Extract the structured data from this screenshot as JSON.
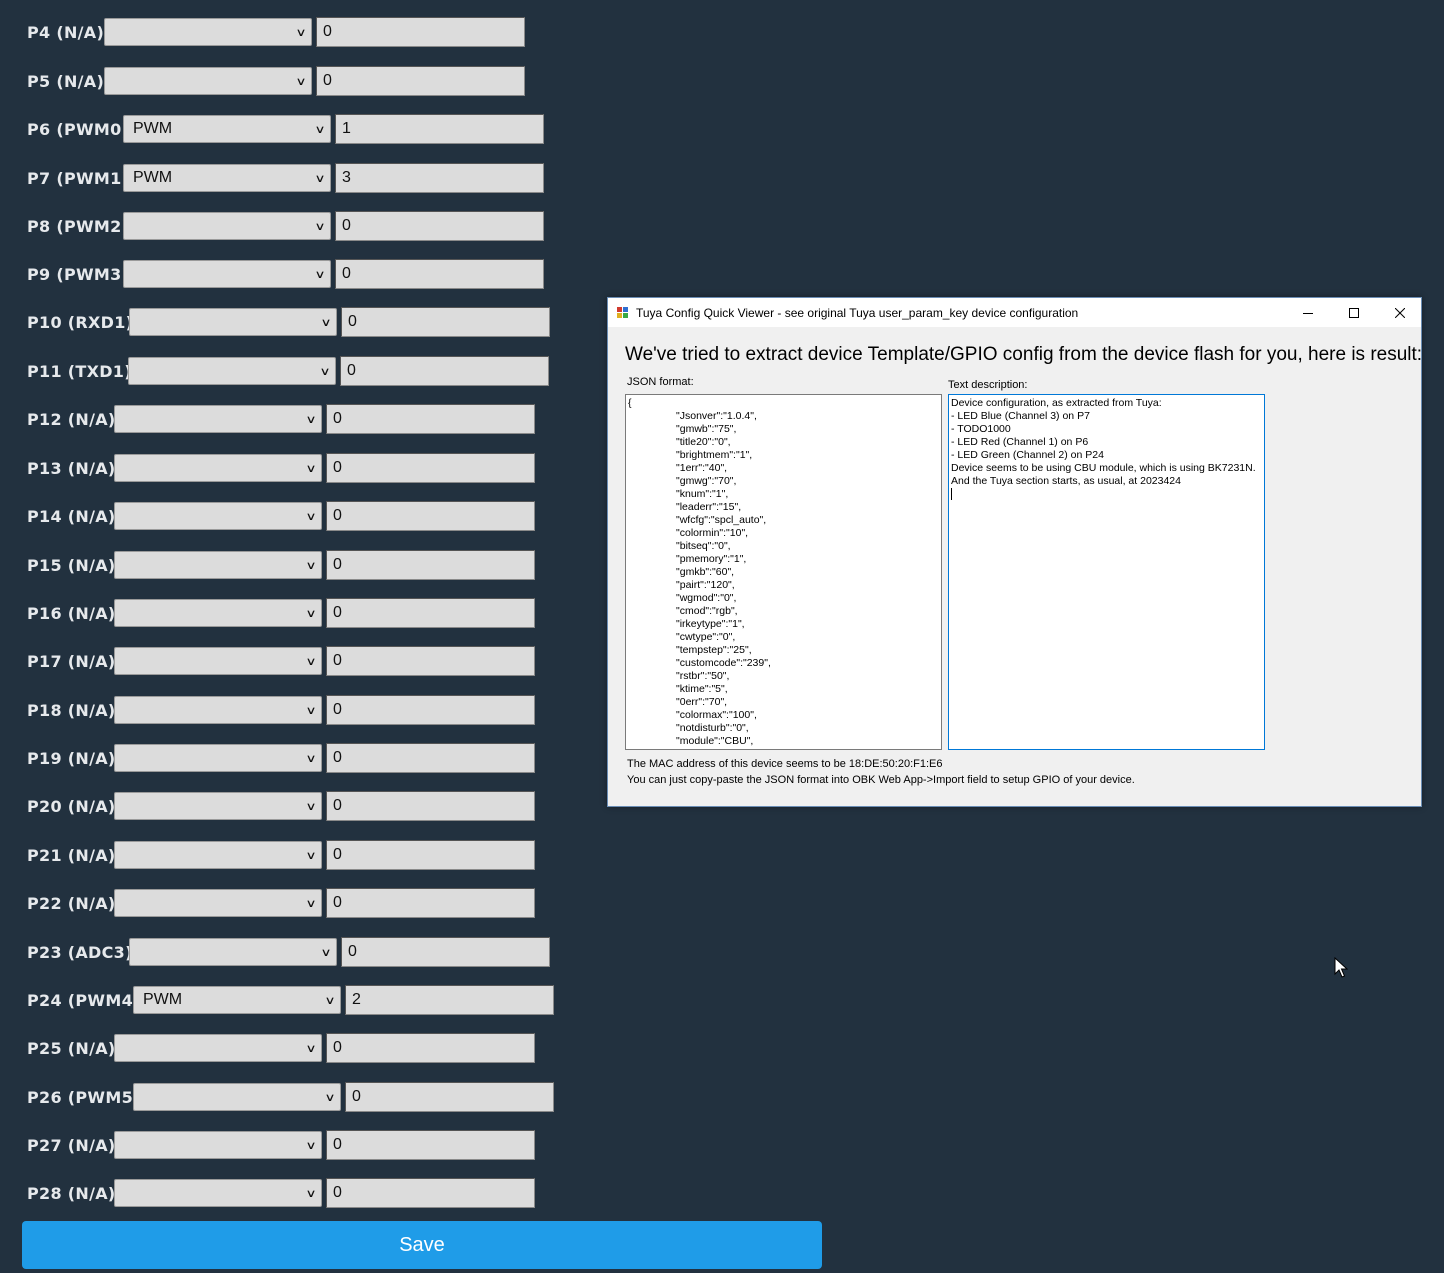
{
  "pins": [
    {
      "label": "P4 (N/A)",
      "role": "",
      "channel": "0"
    },
    {
      "label": "P5 (N/A)",
      "role": "",
      "channel": "0"
    },
    {
      "label": "P6 (PWM0)",
      "role": "PWM",
      "channel": "1"
    },
    {
      "label": "P7 (PWM1)",
      "role": "PWM",
      "channel": "3"
    },
    {
      "label": "P8 (PWM2)",
      "role": "",
      "channel": "0"
    },
    {
      "label": "P9 (PWM3)",
      "role": "",
      "channel": "0"
    },
    {
      "label": "P10 (RXD1)",
      "role": "",
      "channel": "0"
    },
    {
      "label": "P11 (TXD1)",
      "role": "",
      "channel": "0"
    },
    {
      "label": "P12 (N/A)",
      "role": "",
      "channel": "0"
    },
    {
      "label": "P13 (N/A)",
      "role": "",
      "channel": "0"
    },
    {
      "label": "P14 (N/A)",
      "role": "",
      "channel": "0"
    },
    {
      "label": "P15 (N/A)",
      "role": "",
      "channel": "0"
    },
    {
      "label": "P16 (N/A)",
      "role": "",
      "channel": "0"
    },
    {
      "label": "P17 (N/A)",
      "role": "",
      "channel": "0"
    },
    {
      "label": "P18 (N/A)",
      "role": "",
      "channel": "0"
    },
    {
      "label": "P19 (N/A)",
      "role": "",
      "channel": "0"
    },
    {
      "label": "P20 (N/A)",
      "role": "",
      "channel": "0"
    },
    {
      "label": "P21 (N/A)",
      "role": "",
      "channel": "0"
    },
    {
      "label": "P22 (N/A)",
      "role": "",
      "channel": "0"
    },
    {
      "label": "P23 (ADC3)",
      "role": "",
      "channel": "0"
    },
    {
      "label": "P24 (PWM4)",
      "role": "PWM",
      "channel": "2"
    },
    {
      "label": "P25 (N/A)",
      "role": "",
      "channel": "0"
    },
    {
      "label": "P26 (PWM5)",
      "role": "",
      "channel": "0"
    },
    {
      "label": "P27 (N/A)",
      "role": "",
      "channel": "0"
    },
    {
      "label": "P28 (N/A)",
      "role": "",
      "channel": "0"
    }
  ],
  "save_label": "Save",
  "colors": {
    "page_bg": "#22313f",
    "save_button": "#1f9ce8",
    "input_bg": "#dcdcdc"
  },
  "dialog": {
    "title": "Tuya Config Quick Viewer - see original Tuya user_param_key device configuration",
    "heading": "We've tried to extract device Template/GPIO config from the device flash for you, here is result:",
    "json_label": "JSON format:",
    "text_label": "Text description:",
    "json_lines": [
      "{",
      "\"Jsonver\":\"1.0.4\",",
      "\"gmwb\":\"75\",",
      "\"title20\":\"0\",",
      "\"brightmem\":\"1\",",
      "\"1err\":\"40\",",
      "\"gmwg\":\"70\",",
      "\"knum\":\"1\",",
      "\"leaderr\":\"15\",",
      "\"wfcfg\":\"spcl_auto\",",
      "\"colormin\":\"10\",",
      "\"bitseq\":\"0\",",
      "\"pmemory\":\"1\",",
      "\"gmkb\":\"60\",",
      "\"pairt\":\"120\",",
      "\"wgmod\":\"0\",",
      "\"cmod\":\"rgb\",",
      "\"irkeytype\":\"1\",",
      "\"cwtype\":\"0\",",
      "\"tempstep\":\"25\",",
      "\"customcode\":\"239\",",
      "\"rstbr\":\"50\",",
      "\"ktime\":\"5\",",
      "\"0err\":\"70\",",
      "\"colormax\":\"100\",",
      "\"notdisturb\":\"0\",",
      "\"module\":\"CBU\","
    ],
    "text_lines": [
      "Device configuration, as extracted from Tuya:",
      "- LED Blue (Channel 3) on P7",
      "- TODO1000",
      "- LED Red (Channel 1) on P6",
      "- LED Green (Channel 2) on P24",
      "Device seems to be using CBU module, which is using BK7231N.",
      "And the Tuya section starts, as usual, at 2023424"
    ],
    "mac_text": "The MAC address of this device seems to be 18:DE:50:20:F1:E6",
    "hint_text": "You can just copy-paste the JSON format into OBK Web App->Import field to setup GPIO of your device.",
    "minimize_icon": "minimize-icon",
    "maximize_icon": "maximize-icon",
    "close_icon": "close-icon"
  }
}
